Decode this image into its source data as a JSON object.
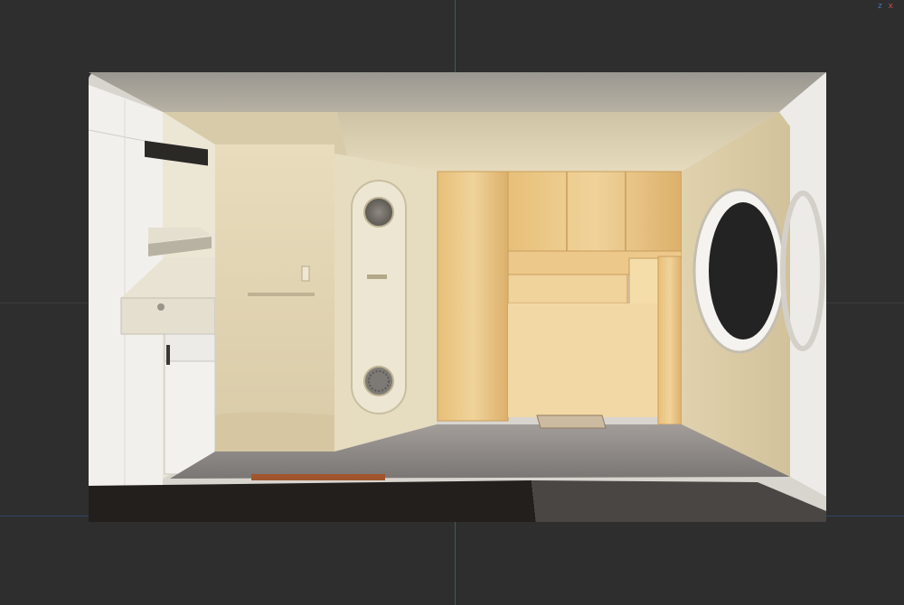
{
  "viewer": {
    "background": "#2e2e2e",
    "gizmo": {
      "z_label": "z",
      "x_label": "x"
    }
  },
  "scene": {
    "colors": {
      "wall": "#e4d8b9",
      "ceiling": "#ded4b8",
      "wood": "#e9c581",
      "wood_dark": "#d5a864",
      "carpet": "#8b8784",
      "white_panel": "#f1f0ec",
      "window": "#252525",
      "floor_strip": "#1f1d1c"
    }
  }
}
